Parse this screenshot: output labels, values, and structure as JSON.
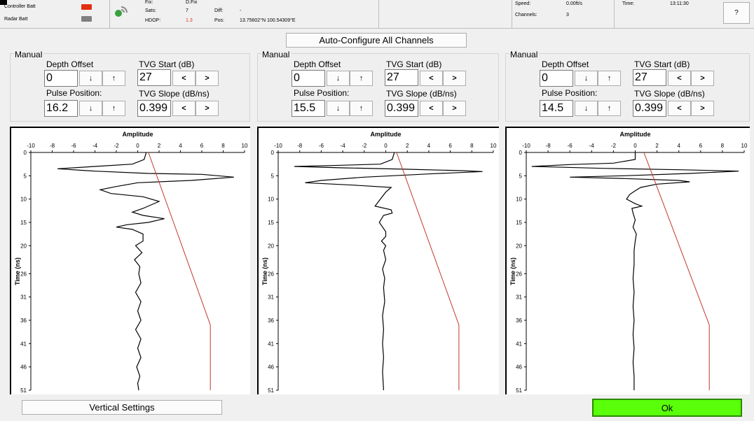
{
  "status": {
    "controller_batt_label": "Controller Batt",
    "radar_batt_label": "Radar Batt",
    "fix_label": "Fix:",
    "fix_value": "D.Fix",
    "sats_label": "Sats:",
    "sats_value": "7",
    "hdop_label": "HDOP:",
    "hdop_value": "1.3",
    "diff_label": "Diff:",
    "diff_value": "-",
    "pos_label": "Pos:",
    "pos_value": "13.75602°N 100.54309°E",
    "speed_label": "Speed:",
    "speed_value": "0.00ft/s",
    "channels_label": "Channels:",
    "channels_value": "3",
    "time_label": "Time:",
    "time_value": "13:11:30",
    "help_label": "?"
  },
  "colors": {
    "battery_red": "#e03010",
    "battery_gray": "#808080",
    "ok_green": "#5aff0a",
    "tvg_line": "#c0392b",
    "hdop_value": "#e03010"
  },
  "auto_configure_label": "Auto-Configure All Channels",
  "common_labels": {
    "manual": "Manual",
    "depth_offset": "Depth Offset",
    "pulse_position": "Pulse Position:",
    "tvg_start": "TVG Start (dB)",
    "tvg_slope": "TVG Slope (dB/ns)",
    "down": "↓",
    "up": "↑",
    "less": "<",
    "greater": ">"
  },
  "channels": [
    {
      "depth_offset": "0",
      "pulse_position": "16.2",
      "tvg_start": "27",
      "tvg_slope": "0.399"
    },
    {
      "depth_offset": "0",
      "pulse_position": "15.5",
      "tvg_start": "27",
      "tvg_slope": "0.399"
    },
    {
      "depth_offset": "0",
      "pulse_position": "14.5",
      "tvg_start": "27",
      "tvg_slope": "0.399"
    }
  ],
  "chart_data": [
    {
      "type": "line",
      "xlabel": "Amplitude",
      "ylabel": "Time (ns)",
      "xlim": [
        -10,
        10
      ],
      "ylim": [
        51,
        0
      ],
      "x_ticks": [
        -10,
        -8,
        -6,
        -4,
        -2,
        0,
        2,
        4,
        6,
        8,
        10
      ],
      "y_ticks": [
        0,
        5,
        10,
        15,
        20,
        26,
        31,
        36,
        41,
        46,
        51
      ],
      "series": [
        {
          "points": [
            [
              0.8,
              0
            ],
            [
              0.6,
              1.5
            ],
            [
              -0.5,
              2.5
            ],
            [
              -4,
              3
            ],
            [
              -7.5,
              3.5
            ],
            [
              -4,
              4
            ],
            [
              1,
              4.5
            ],
            [
              6,
              4.7
            ],
            [
              9,
              5.3
            ],
            [
              5,
              6
            ],
            [
              0,
              6.5
            ],
            [
              -2,
              7.3
            ],
            [
              -3.5,
              8
            ],
            [
              -2.5,
              8.8
            ],
            [
              0.5,
              9.5
            ],
            [
              2,
              10.5
            ],
            [
              0.5,
              12
            ],
            [
              -0.5,
              12.8
            ],
            [
              0.5,
              13.5
            ],
            [
              2.5,
              14.2
            ],
            [
              1,
              15
            ],
            [
              -1,
              15.5
            ],
            [
              -2,
              16
            ],
            [
              -0.5,
              16.5
            ],
            [
              0.5,
              17.5
            ],
            [
              0.5,
              19
            ],
            [
              -0.2,
              20
            ],
            [
              0.4,
              21.5
            ],
            [
              -0.3,
              23
            ],
            [
              0.2,
              24.5
            ],
            [
              0.1,
              26
            ],
            [
              0.3,
              28
            ],
            [
              -0.2,
              30
            ],
            [
              0.3,
              32
            ],
            [
              0,
              34
            ],
            [
              0.3,
              36
            ],
            [
              -0.2,
              38
            ],
            [
              0.3,
              40
            ],
            [
              0,
              42
            ],
            [
              0.3,
              44
            ],
            [
              -0.1,
              46
            ],
            [
              0.2,
              48
            ],
            [
              0,
              49.5
            ],
            [
              0.1,
              51
            ]
          ]
        },
        {
          "points": [
            [
              1,
              0
            ],
            [
              6.8,
              37
            ],
            [
              6.8,
              51
            ]
          ]
        }
      ]
    },
    {
      "type": "line",
      "xlabel": "Amplitude",
      "ylabel": "Time (ns)",
      "xlim": [
        -10,
        10
      ],
      "ylim": [
        51,
        0
      ],
      "x_ticks": [
        -10,
        -8,
        -6,
        -4,
        -2,
        0,
        2,
        4,
        6,
        8,
        10
      ],
      "y_ticks": [
        0,
        5,
        10,
        15,
        20,
        26,
        31,
        36,
        41,
        46,
        51
      ],
      "series": [
        {
          "points": [
            [
              0.8,
              0
            ],
            [
              0.6,
              1.5
            ],
            [
              -0.5,
              2.5
            ],
            [
              -5,
              2.8
            ],
            [
              -8.5,
              3
            ],
            [
              -4,
              3.3
            ],
            [
              2,
              3.6
            ],
            [
              7,
              3.9
            ],
            [
              9,
              4.1
            ],
            [
              4,
              4.6
            ],
            [
              -2,
              5.3
            ],
            [
              -6,
              6
            ],
            [
              -7.5,
              6.5
            ],
            [
              -3,
              7
            ],
            [
              0.5,
              7.5
            ],
            [
              0,
              8.5
            ],
            [
              -0.5,
              10
            ],
            [
              -1,
              11.5
            ],
            [
              0.5,
              12.3
            ],
            [
              0.6,
              13
            ],
            [
              -0.2,
              13.5
            ],
            [
              -0.6,
              15
            ],
            [
              0,
              17
            ],
            [
              0,
              18
            ],
            [
              -0.4,
              19
            ],
            [
              0,
              20
            ],
            [
              -0.2,
              21
            ],
            [
              0,
              23
            ],
            [
              -0.3,
              25
            ],
            [
              -0.1,
              27
            ],
            [
              -0.2,
              29
            ],
            [
              -0.1,
              32
            ],
            [
              -0.3,
              35
            ],
            [
              -0.2,
              38
            ],
            [
              -0.3,
              41
            ],
            [
              -0.2,
              44
            ],
            [
              -0.3,
              47
            ],
            [
              -0.2,
              51
            ]
          ]
        },
        {
          "points": [
            [
              1,
              0
            ],
            [
              6.8,
              37
            ],
            [
              6.8,
              51
            ]
          ]
        }
      ]
    },
    {
      "type": "line",
      "xlabel": "Amplitude",
      "ylabel": "Time (ns)",
      "xlim": [
        -10,
        10
      ],
      "ylim": [
        51,
        0
      ],
      "x_ticks": [
        -10,
        -8,
        -6,
        -4,
        -2,
        0,
        2,
        4,
        6,
        8,
        10
      ],
      "y_ticks": [
        0,
        5,
        10,
        15,
        20,
        26,
        31,
        36,
        41,
        46,
        51
      ],
      "series": [
        {
          "points": [
            [
              0,
              0
            ],
            [
              0,
              1.5
            ],
            [
              -2,
              2.3
            ],
            [
              -6,
              2.6
            ],
            [
              -9.5,
              3
            ],
            [
              -3,
              3.4
            ],
            [
              4,
              3.7
            ],
            [
              9.5,
              4
            ],
            [
              5,
              4.5
            ],
            [
              -1,
              5
            ],
            [
              -6,
              5.3
            ],
            [
              -1,
              5.6
            ],
            [
              4,
              6
            ],
            [
              5,
              6.3
            ],
            [
              2,
              6.8
            ],
            [
              0.5,
              7.5
            ],
            [
              0,
              8.2
            ],
            [
              -0.5,
              9
            ],
            [
              -0.8,
              10
            ],
            [
              0,
              11
            ],
            [
              0.6,
              11.5
            ],
            [
              -0.3,
              12
            ],
            [
              -0.2,
              13
            ],
            [
              0,
              14.5
            ],
            [
              -0.2,
              16
            ],
            [
              0.1,
              17.5
            ],
            [
              0,
              19
            ],
            [
              -0.1,
              21
            ],
            [
              -0.1,
              24
            ],
            [
              -0.2,
              27
            ],
            [
              -0.1,
              30
            ],
            [
              -0.2,
              33
            ],
            [
              -0.1,
              36
            ],
            [
              -0.2,
              39
            ],
            [
              -0.1,
              42
            ],
            [
              -0.2,
              45
            ],
            [
              -0.1,
              48
            ],
            [
              -0.1,
              51
            ]
          ]
        },
        {
          "points": [
            [
              0.8,
              0
            ],
            [
              6.8,
              37
            ],
            [
              6.8,
              51
            ]
          ]
        }
      ]
    }
  ],
  "vertical_settings_label": "Vertical Settings",
  "ok_label": "Ok"
}
